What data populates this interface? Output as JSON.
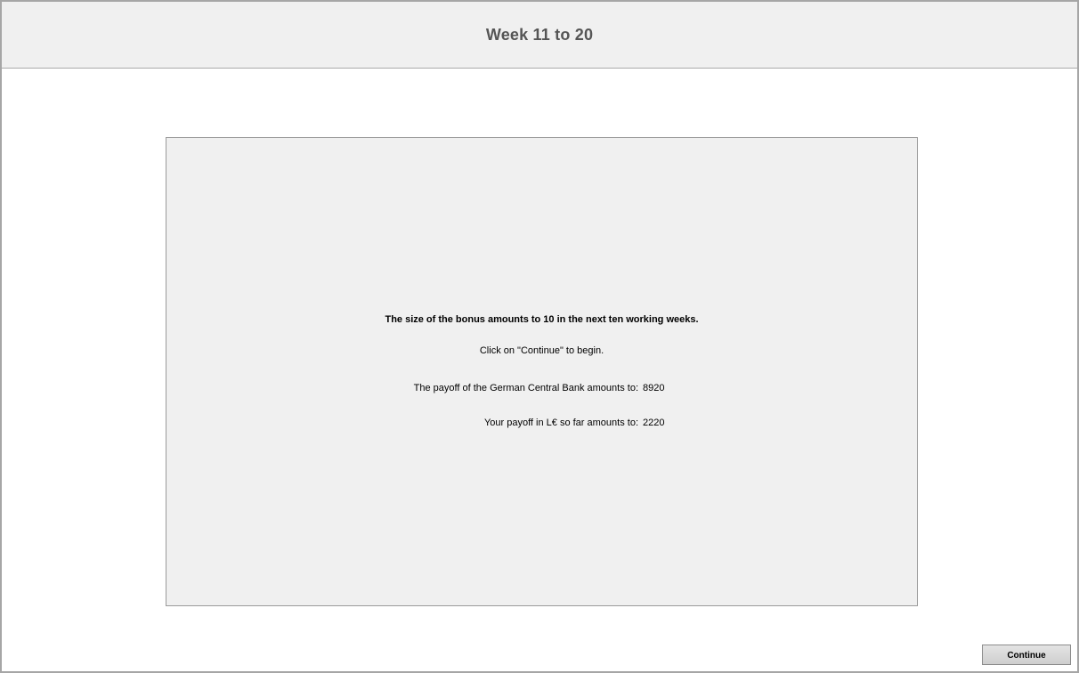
{
  "header": {
    "title": "Week 11 to 20"
  },
  "panel": {
    "headline": "The size of the bonus amounts to 10 in the next ten working weeks.",
    "instruction": "Click on \"Continue\" to begin.",
    "bank_payoff_label": "The payoff of the German Central Bank amounts to:",
    "bank_payoff_value": "8920",
    "your_payoff_label": "Your payoff in L€ so far amounts to:",
    "your_payoff_value": "2220"
  },
  "footer": {
    "continue_label": "Continue"
  },
  "colors": {
    "header_bg": "#f0f0f0",
    "panel_bg": "#f0f0f0",
    "title_text": "#555555"
  }
}
